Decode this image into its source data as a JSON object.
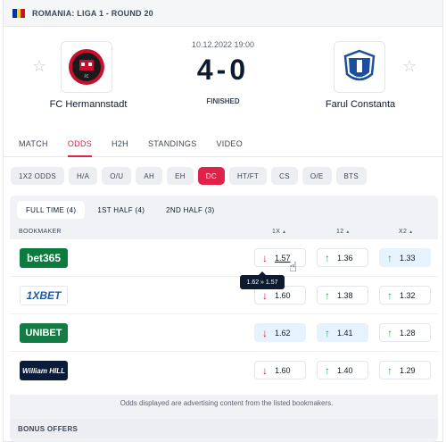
{
  "topbar": {
    "league": "ROMANIA: LIGA 1 - ROUND 20",
    "flag_colors": [
      "#0033a0",
      "#fcd116",
      "#ce1126"
    ]
  },
  "match": {
    "date": "10.12.2022 19:00",
    "score": "4-0",
    "status": "FINISHED",
    "home": {
      "name": "FC Hermannstadt",
      "logo_text": "HERMANNSTADT"
    },
    "away": {
      "name": "Farul Constanta",
      "logo_text": "FCF"
    }
  },
  "tabs": [
    "MATCH",
    "ODDS",
    "H2H",
    "STANDINGS",
    "VIDEO"
  ],
  "active_tab": "ODDS",
  "bet_types": [
    "1X2 ODDS",
    "H/A",
    "O/U",
    "AH",
    "EH",
    "DC",
    "HT/FT",
    "CS",
    "O/E",
    "BTS"
  ],
  "active_bet_type": "DC",
  "periods": [
    "FULL TIME (4)",
    "1ST HALF (4)",
    "2ND HALF (3)"
  ],
  "active_period": "FULL TIME (4)",
  "table": {
    "columns": {
      "bookmaker": "BOOKMAKER",
      "c1": "1X",
      "c2": "12",
      "c3": "X2"
    },
    "rows": [
      {
        "bookmaker": "bet365",
        "color": "#0c7b3e",
        "odds": [
          {
            "value": "1.57",
            "trend": "down",
            "highlight": false
          },
          {
            "value": "1.36",
            "trend": "up",
            "highlight": false
          },
          {
            "value": "1.33",
            "trend": "up",
            "highlight": true
          }
        ]
      },
      {
        "bookmaker": "1XBET",
        "color": "#ffffff",
        "odds": [
          {
            "value": "1.60",
            "trend": "down",
            "highlight": false
          },
          {
            "value": "1.38",
            "trend": "up",
            "highlight": false
          },
          {
            "value": "1.32",
            "trend": "up",
            "highlight": false
          }
        ]
      },
      {
        "bookmaker": "UNIBET",
        "color": "#147b45",
        "odds": [
          {
            "value": "1.62",
            "trend": "down",
            "highlight": true
          },
          {
            "value": "1.41",
            "trend": "up",
            "highlight": true
          },
          {
            "value": "1.28",
            "trend": "up",
            "highlight": false
          }
        ]
      },
      {
        "bookmaker": "William HILL",
        "color": "#0b1c3b",
        "odds": [
          {
            "value": "1.60",
            "trend": "down",
            "highlight": false
          },
          {
            "value": "1.40",
            "trend": "up",
            "highlight": false
          },
          {
            "value": "1.29",
            "trend": "up",
            "highlight": false
          }
        ]
      }
    ]
  },
  "tooltip": "1.62 » 1.57",
  "disclaimer": "Odds displayed are advertising content from the listed bookmakers.",
  "bonus": "BONUS OFFERS"
}
